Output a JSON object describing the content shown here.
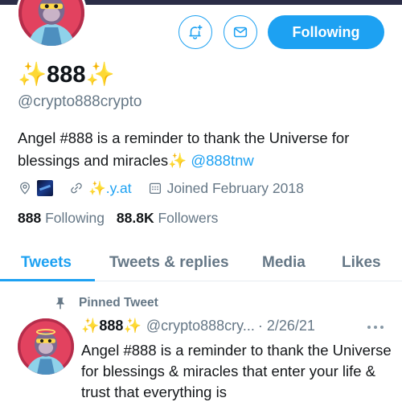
{
  "profile": {
    "display_name": "✨888✨",
    "handle": "@crypto888crypto",
    "bio_text": "Angel #888 is a reminder to thank the Universe for blessings and miracles✨ ",
    "bio_mention": "@888tnw",
    "link_text": "✨.y.at",
    "joined_label": "Joined February 2018",
    "following_count": "888",
    "following_label": "Following",
    "followers_count": "88.8K",
    "followers_label": "Followers"
  },
  "actions": {
    "following_button": "Following",
    "notify_icon": "bell-plus-icon",
    "message_icon": "envelope-icon"
  },
  "tabs": [
    {
      "label": "Tweets",
      "active": true
    },
    {
      "label": "Tweets & replies",
      "active": false
    },
    {
      "label": "Media",
      "active": false
    },
    {
      "label": "Likes",
      "active": false
    }
  ],
  "tweet": {
    "pinned_label": "Pinned Tweet",
    "name": "✨888✨",
    "handle": "@crypto888cry...",
    "date": "· 2/26/21",
    "text": "Angel #888 is a reminder to thank the Universe for blessings & miracles that enter your life & trust that everything is"
  },
  "colors": {
    "accent": "#1da1f2",
    "secondary_text": "#657786",
    "banner": "#2b2d47"
  }
}
